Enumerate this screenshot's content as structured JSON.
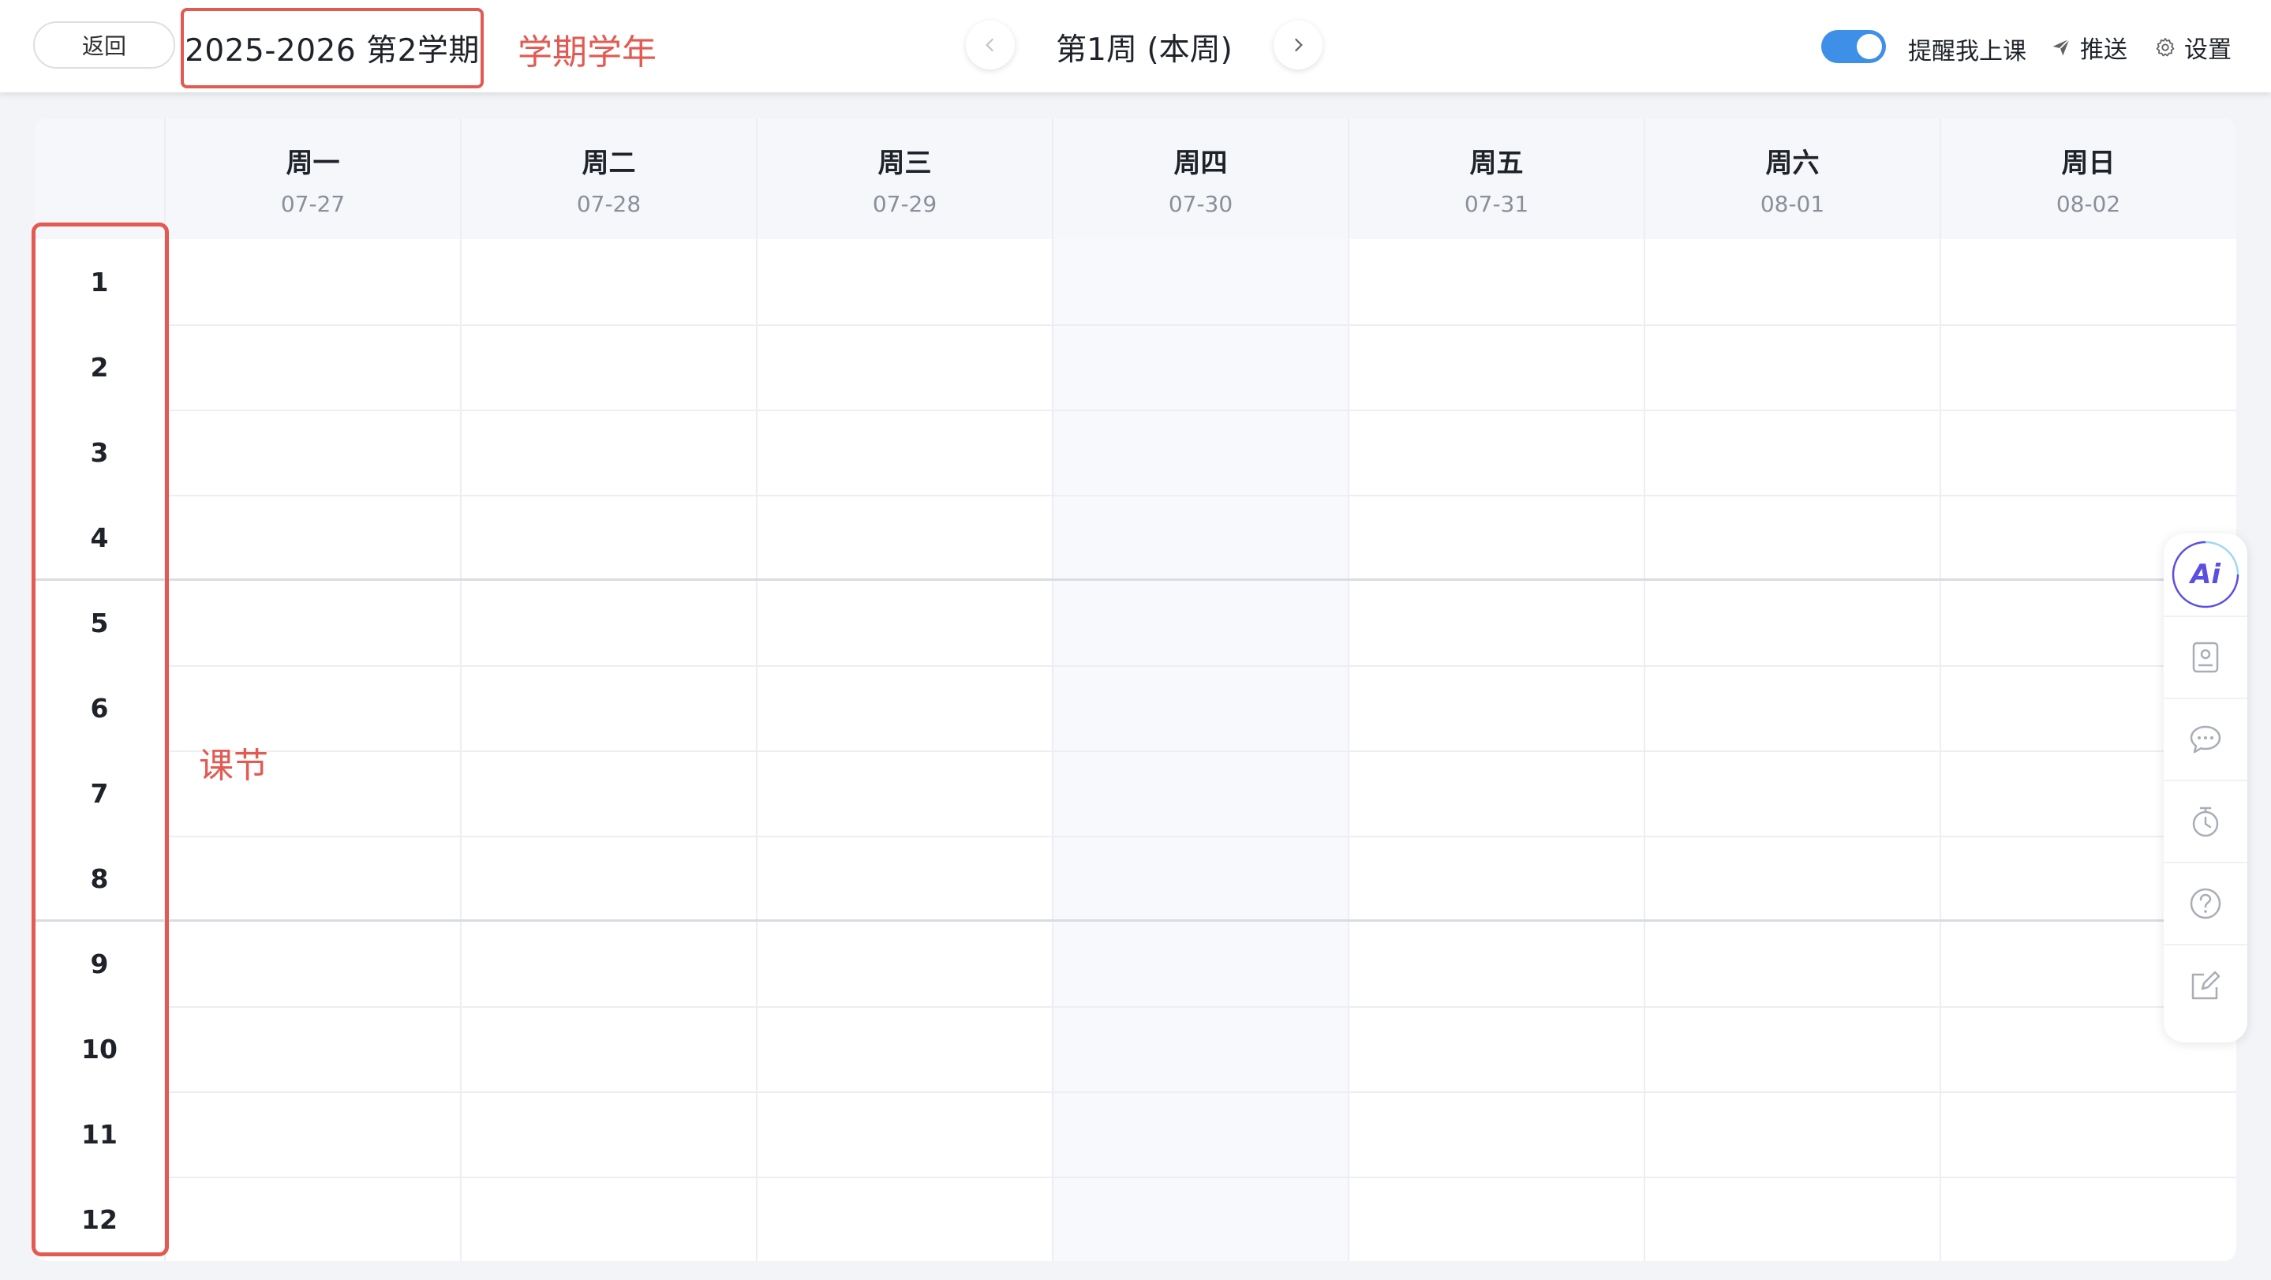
{
  "topbar": {
    "back_label": "返回",
    "term": "2025-2026 第2学期",
    "term_annotation": "学期学年",
    "week_title": "第1周 (本周)",
    "remind_label": "提醒我上课",
    "remind_enabled": true,
    "push_label": "推送",
    "settings_label": "设置"
  },
  "timetable": {
    "days": [
      {
        "name": "周一",
        "date": "07-27"
      },
      {
        "name": "周二",
        "date": "07-28"
      },
      {
        "name": "周三",
        "date": "07-29"
      },
      {
        "name": "周四",
        "date": "07-30"
      },
      {
        "name": "周五",
        "date": "07-31"
      },
      {
        "name": "周六",
        "date": "08-01"
      },
      {
        "name": "周日",
        "date": "08-02"
      }
    ],
    "highlighted_day": "周四",
    "periods": [
      "1",
      "2",
      "3",
      "4",
      "5",
      "6",
      "7",
      "8",
      "9",
      "10",
      "11",
      "12"
    ],
    "period_annotation": "课节"
  },
  "side_tools": {
    "ai_label": "Ai",
    "items": [
      "ai-assistant-icon",
      "contact-card-icon",
      "chat-icon",
      "timer-icon",
      "help-icon",
      "edit-icon"
    ]
  },
  "colors": {
    "accent": "#3d8fe8",
    "annotation": "#e25a52",
    "ai": "#5a4fe0"
  }
}
